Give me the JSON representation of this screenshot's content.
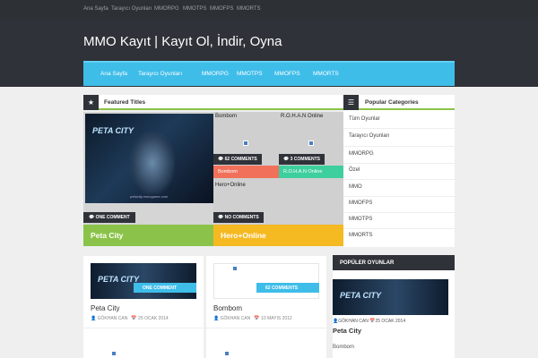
{
  "topbar": {
    "items": [
      "Ana Sayfa",
      "Tarayıcı Oyunları",
      "MMORPG",
      "MMOTPS",
      "MMOFPS",
      "MMORTS"
    ]
  },
  "header": {
    "site_title": "MMO Kayıt | Kayıt Ol, İndir, Oyna"
  },
  "mainnav": {
    "items": [
      "Ana Sayfa",
      "Tarayıcı Oyunları",
      "MMORPG",
      "MMOTPS",
      "MMOFPS",
      "MMORTS"
    ]
  },
  "featured": {
    "heading": "Featured Titles",
    "big": {
      "logo": "PETA CITY",
      "url": "petacity.mmogame.com",
      "comments": "ONE COMMENT",
      "title": "Peta City"
    },
    "small1": {
      "name": "Bombom",
      "comments": "62 COMMENTS",
      "bar": "Bombom"
    },
    "small2": {
      "name": "R.O.H.A.N Online",
      "comments": "3 COMMENTS",
      "bar": "R.O.H.A.N Online"
    },
    "bottom": {
      "name": "Hero+Online",
      "comments": "NO COMMENTS",
      "title": "Hero+Online"
    }
  },
  "categories": {
    "heading": "Popular Categories",
    "items": [
      "Tüm Oyunlar",
      "Tarayıcı Oyunları",
      "MMORPG",
      "Özel",
      "MMO",
      "MMOFPS",
      "MMOTPS",
      "MMORTS"
    ]
  },
  "posts": [
    {
      "logo": "PETA CITY",
      "comments": "ONE COMMENT",
      "title": "Peta City",
      "author": "GÖKHAN CAN",
      "date": "25 OCAK 2014"
    },
    {
      "comments": "62 COMMENTS",
      "title": "Bombom",
      "author": "GÖKHAN CAN",
      "date": "10 MAYIS 2012"
    }
  ],
  "popular": {
    "heading": "POPÜLER OYUNLAR",
    "logo": "PETA CITY",
    "author": "GÖKHAN CAN",
    "date": "25 OCAK 2014",
    "title": "Peta City",
    "next": "Bombom"
  },
  "colors": {
    "accent_blue": "#3fbde9",
    "accent_green": "#8bc34a",
    "accent_orange": "#f5b922",
    "accent_red": "#f0705a",
    "accent_teal": "#3ecf9e",
    "dark": "#2f3238"
  }
}
